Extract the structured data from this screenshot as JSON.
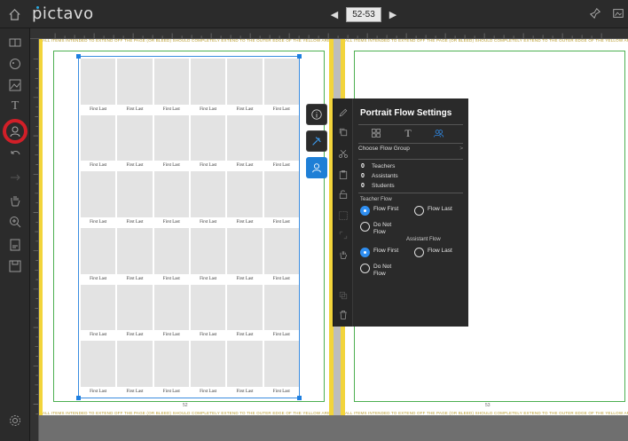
{
  "app": {
    "logo": "pictavo"
  },
  "nav": {
    "current_pages": "52-53"
  },
  "canvas": {
    "bleed_notice": "ALL ITEMS INTENDED TO EXTEND OFF THE PAGE (OR BLEED) SHOULD COMPLETELY EXTEND TO THE OUTER EDGE OF THE YELLOW AREA",
    "left_page_number": "52",
    "right_page_number": "53",
    "portrait_name": "First Last",
    "portrait_rows": 6,
    "portrait_cols": 6
  },
  "flow_panel": {
    "title": "Portrait Flow Settings",
    "choose_group": "Choose Flow Group",
    "counts": [
      {
        "value": "0",
        "label": "Teachers"
      },
      {
        "value": "0",
        "label": "Assistants"
      },
      {
        "value": "0",
        "label": "Students"
      }
    ],
    "teacher_flow_label": "Teacher Flow",
    "assistant_flow_label": "Assistant Flow",
    "teacher_options": {
      "first": "Flow First",
      "last": "Flow Last",
      "none": "Do Not Flow"
    },
    "assistant_options": {
      "first": "Flow First",
      "last": "Flow Last",
      "none": "Do Not Flow"
    },
    "teacher_selected": "first",
    "assistant_selected": "first"
  },
  "colors": {
    "accent": "#2f8ef0",
    "highlight": "#d11f28",
    "bleed": "#f2d43b",
    "safe": "#4caf50"
  }
}
